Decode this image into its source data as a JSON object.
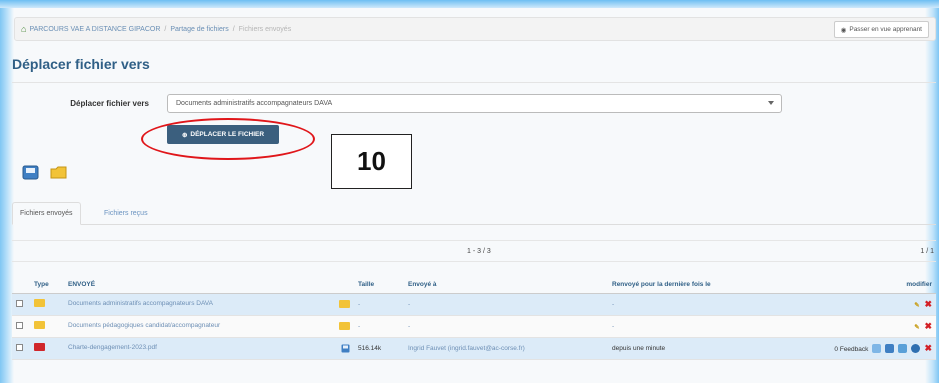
{
  "breadcrumb": {
    "items": [
      "PARCOURS VAE A DISTANCE GIPACOR",
      "Partage de fichiers",
      "Fichiers envoyés"
    ]
  },
  "header": {
    "learner_button": "Passer en vue apprenant"
  },
  "page": {
    "title": "Déplacer fichier vers"
  },
  "form": {
    "label": "Déplacer fichier vers",
    "select_value": "Documents administratifs accompagnateurs DAVA",
    "move_button": "DÉPLACER LE FICHIER"
  },
  "annotation": {
    "callout_number": "10"
  },
  "toolbar": {
    "icons": [
      "save-icon",
      "folder-icon"
    ]
  },
  "tabs": [
    {
      "label": "Fichiers envoyés",
      "active": true
    },
    {
      "label": "Fichiers reçus",
      "active": false
    }
  ],
  "pager": {
    "range": "1 - 3 / 3",
    "pages": "1 / 1"
  },
  "table": {
    "headers": [
      "Type",
      "ENVOYÉ",
      "Taille",
      "Envoyé à",
      "Renvoyé pour la dernière fois le",
      "modifier"
    ],
    "rows": [
      {
        "type": "folder",
        "name": "Documents administratifs accompagnateurs DAVA",
        "size": "-",
        "sent_to": "-",
        "resent": "-",
        "extra": ""
      },
      {
        "type": "folder",
        "name": "Documents pédagogiques candidat/accompagnateur",
        "size": "-",
        "sent_to": "-",
        "resent": "-",
        "extra": ""
      },
      {
        "type": "pdf",
        "name": "Charte-dengagement-2023.pdf",
        "size": "516.14k",
        "sent_to": "Ingrid Fauvet (ingrid.fauvet@ac-corse.fr)",
        "resent": "depuis une minute",
        "extra": "0 Feedback"
      }
    ]
  },
  "colors": {
    "accent": "#2f5f86",
    "button": "#3b5f7e",
    "highlight": "#e0161a",
    "row_alt": "#dcebf8"
  }
}
